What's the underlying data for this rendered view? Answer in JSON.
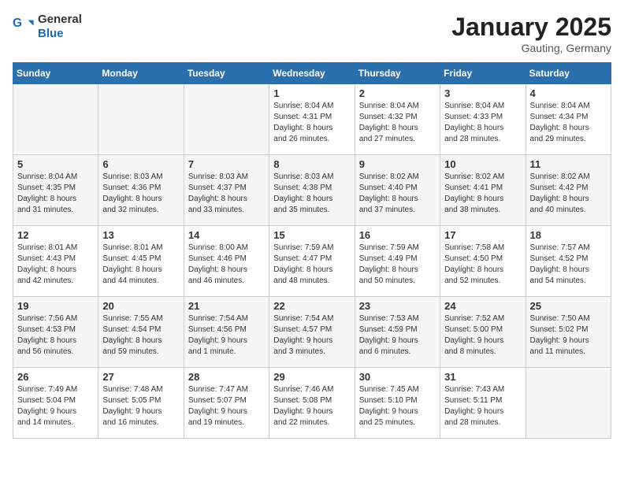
{
  "logo": {
    "text_general": "General",
    "text_blue": "Blue"
  },
  "header": {
    "month_year": "January 2025",
    "location": "Gauting, Germany"
  },
  "weekdays": [
    "Sunday",
    "Monday",
    "Tuesday",
    "Wednesday",
    "Thursday",
    "Friday",
    "Saturday"
  ],
  "weeks": [
    [
      {
        "day": "",
        "info": ""
      },
      {
        "day": "",
        "info": ""
      },
      {
        "day": "",
        "info": ""
      },
      {
        "day": "1",
        "info": "Sunrise: 8:04 AM\nSunset: 4:31 PM\nDaylight: 8 hours\nand 26 minutes."
      },
      {
        "day": "2",
        "info": "Sunrise: 8:04 AM\nSunset: 4:32 PM\nDaylight: 8 hours\nand 27 minutes."
      },
      {
        "day": "3",
        "info": "Sunrise: 8:04 AM\nSunset: 4:33 PM\nDaylight: 8 hours\nand 28 minutes."
      },
      {
        "day": "4",
        "info": "Sunrise: 8:04 AM\nSunset: 4:34 PM\nDaylight: 8 hours\nand 29 minutes."
      }
    ],
    [
      {
        "day": "5",
        "info": "Sunrise: 8:04 AM\nSunset: 4:35 PM\nDaylight: 8 hours\nand 31 minutes."
      },
      {
        "day": "6",
        "info": "Sunrise: 8:03 AM\nSunset: 4:36 PM\nDaylight: 8 hours\nand 32 minutes."
      },
      {
        "day": "7",
        "info": "Sunrise: 8:03 AM\nSunset: 4:37 PM\nDaylight: 8 hours\nand 33 minutes."
      },
      {
        "day": "8",
        "info": "Sunrise: 8:03 AM\nSunset: 4:38 PM\nDaylight: 8 hours\nand 35 minutes."
      },
      {
        "day": "9",
        "info": "Sunrise: 8:02 AM\nSunset: 4:40 PM\nDaylight: 8 hours\nand 37 minutes."
      },
      {
        "day": "10",
        "info": "Sunrise: 8:02 AM\nSunset: 4:41 PM\nDaylight: 8 hours\nand 38 minutes."
      },
      {
        "day": "11",
        "info": "Sunrise: 8:02 AM\nSunset: 4:42 PM\nDaylight: 8 hours\nand 40 minutes."
      }
    ],
    [
      {
        "day": "12",
        "info": "Sunrise: 8:01 AM\nSunset: 4:43 PM\nDaylight: 8 hours\nand 42 minutes."
      },
      {
        "day": "13",
        "info": "Sunrise: 8:01 AM\nSunset: 4:45 PM\nDaylight: 8 hours\nand 44 minutes."
      },
      {
        "day": "14",
        "info": "Sunrise: 8:00 AM\nSunset: 4:46 PM\nDaylight: 8 hours\nand 46 minutes."
      },
      {
        "day": "15",
        "info": "Sunrise: 7:59 AM\nSunset: 4:47 PM\nDaylight: 8 hours\nand 48 minutes."
      },
      {
        "day": "16",
        "info": "Sunrise: 7:59 AM\nSunset: 4:49 PM\nDaylight: 8 hours\nand 50 minutes."
      },
      {
        "day": "17",
        "info": "Sunrise: 7:58 AM\nSunset: 4:50 PM\nDaylight: 8 hours\nand 52 minutes."
      },
      {
        "day": "18",
        "info": "Sunrise: 7:57 AM\nSunset: 4:52 PM\nDaylight: 8 hours\nand 54 minutes."
      }
    ],
    [
      {
        "day": "19",
        "info": "Sunrise: 7:56 AM\nSunset: 4:53 PM\nDaylight: 8 hours\nand 56 minutes."
      },
      {
        "day": "20",
        "info": "Sunrise: 7:55 AM\nSunset: 4:54 PM\nDaylight: 8 hours\nand 59 minutes."
      },
      {
        "day": "21",
        "info": "Sunrise: 7:54 AM\nSunset: 4:56 PM\nDaylight: 9 hours\nand 1 minute."
      },
      {
        "day": "22",
        "info": "Sunrise: 7:54 AM\nSunset: 4:57 PM\nDaylight: 9 hours\nand 3 minutes."
      },
      {
        "day": "23",
        "info": "Sunrise: 7:53 AM\nSunset: 4:59 PM\nDaylight: 9 hours\nand 6 minutes."
      },
      {
        "day": "24",
        "info": "Sunrise: 7:52 AM\nSunset: 5:00 PM\nDaylight: 9 hours\nand 8 minutes."
      },
      {
        "day": "25",
        "info": "Sunrise: 7:50 AM\nSunset: 5:02 PM\nDaylight: 9 hours\nand 11 minutes."
      }
    ],
    [
      {
        "day": "26",
        "info": "Sunrise: 7:49 AM\nSunset: 5:04 PM\nDaylight: 9 hours\nand 14 minutes."
      },
      {
        "day": "27",
        "info": "Sunrise: 7:48 AM\nSunset: 5:05 PM\nDaylight: 9 hours\nand 16 minutes."
      },
      {
        "day": "28",
        "info": "Sunrise: 7:47 AM\nSunset: 5:07 PM\nDaylight: 9 hours\nand 19 minutes."
      },
      {
        "day": "29",
        "info": "Sunrise: 7:46 AM\nSunset: 5:08 PM\nDaylight: 9 hours\nand 22 minutes."
      },
      {
        "day": "30",
        "info": "Sunrise: 7:45 AM\nSunset: 5:10 PM\nDaylight: 9 hours\nand 25 minutes."
      },
      {
        "day": "31",
        "info": "Sunrise: 7:43 AM\nSunset: 5:11 PM\nDaylight: 9 hours\nand 28 minutes."
      },
      {
        "day": "",
        "info": ""
      }
    ]
  ]
}
